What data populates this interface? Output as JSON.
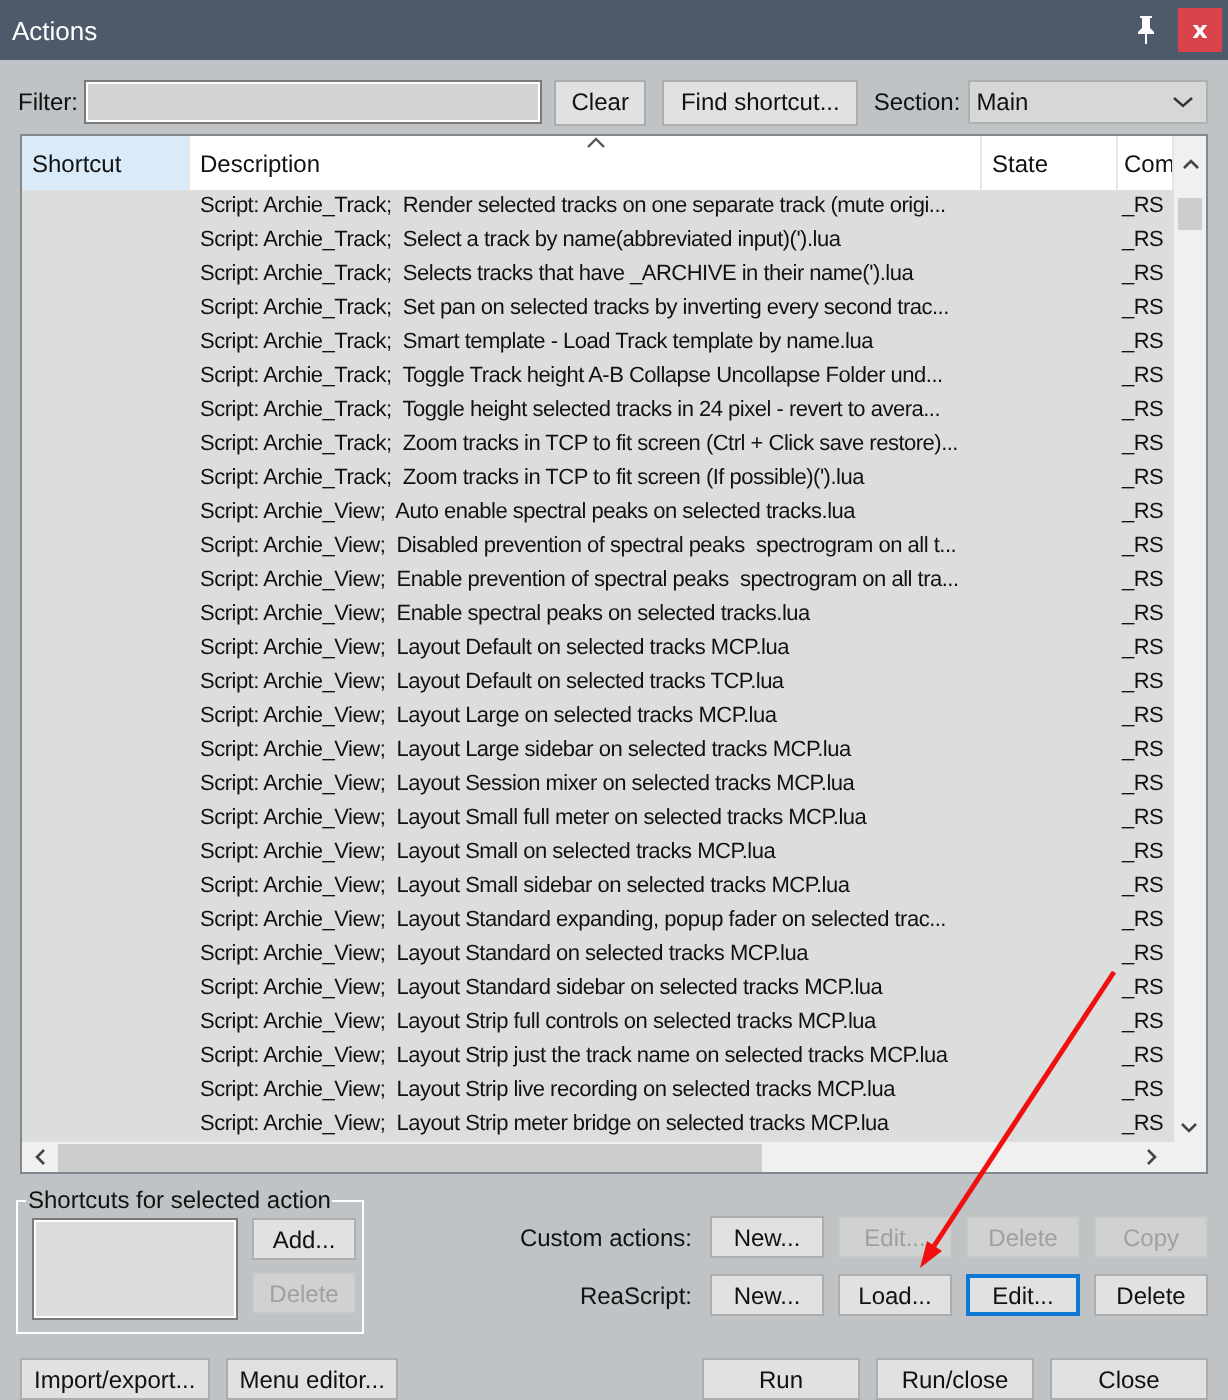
{
  "window": {
    "title": "Actions",
    "close_label": "x"
  },
  "filter": {
    "label": "Filter:"
  },
  "filter_buttons": [
    {
      "label": "Clear"
    },
    {
      "label": "Find shortcut..."
    }
  ],
  "section": {
    "label": "Section:",
    "value": "Main"
  },
  "table": {
    "columns": [
      {
        "label": "Shortcut",
        "selected": true,
        "sorted": false
      },
      {
        "label": "Description",
        "selected": false,
        "sorted": true
      },
      {
        "label": "State",
        "selected": false,
        "sorted": false
      },
      {
        "label": "Com",
        "selected": false,
        "sorted": false
      }
    ],
    "rows": [
      {
        "description": "Script: Archie_Track;  Render selected tracks on one separate track (mute origi...",
        "command": "_RS"
      },
      {
        "description": "Script: Archie_Track;  Select a track by name(abbreviated input)(').lua",
        "command": "_RS"
      },
      {
        "description": "Script: Archie_Track;  Selects tracks that have _ARCHIVE in their name(').lua",
        "command": "_RS"
      },
      {
        "description": "Script: Archie_Track;  Set pan on selected tracks by inverting every second trac...",
        "command": "_RS"
      },
      {
        "description": "Script: Archie_Track;  Smart template - Load Track template by name.lua",
        "command": "_RS"
      },
      {
        "description": "Script: Archie_Track;  Toggle Track height A-B Collapse Uncollapse Folder und...",
        "command": "_RS"
      },
      {
        "description": "Script: Archie_Track;  Toggle height selected tracks in 24 pixel - revert to avera...",
        "command": "_RS"
      },
      {
        "description": "Script: Archie_Track;  Zoom tracks in TCP to fit screen (Ctrl + Click save restore)...",
        "command": "_RS"
      },
      {
        "description": "Script: Archie_Track;  Zoom tracks in TCP to fit screen (If possible)(').lua",
        "command": "_RS"
      },
      {
        "description": "Script: Archie_View;  Auto enable spectral peaks on selected tracks.lua",
        "command": "_RS"
      },
      {
        "description": "Script: Archie_View;  Disabled prevention of spectral peaks  spectrogram on all t...",
        "command": "_RS"
      },
      {
        "description": "Script: Archie_View;  Enable prevention of spectral peaks  spectrogram on all tra...",
        "command": "_RS"
      },
      {
        "description": "Script: Archie_View;  Enable spectral peaks on selected tracks.lua",
        "command": "_RS"
      },
      {
        "description": "Script: Archie_View;  Layout Default on selected tracks MCP.lua",
        "command": "_RS"
      },
      {
        "description": "Script: Archie_View;  Layout Default on selected tracks TCP.lua",
        "command": "_RS"
      },
      {
        "description": "Script: Archie_View;  Layout Large on selected tracks MCP.lua",
        "command": "_RS"
      },
      {
        "description": "Script: Archie_View;  Layout Large sidebar on selected tracks MCP.lua",
        "command": "_RS"
      },
      {
        "description": "Script: Archie_View;  Layout Session mixer on selected tracks MCP.lua",
        "command": "_RS"
      },
      {
        "description": "Script: Archie_View;  Layout Small full meter on selected tracks MCP.lua",
        "command": "_RS"
      },
      {
        "description": "Script: Archie_View;  Layout Small on selected tracks MCP.lua",
        "command": "_RS"
      },
      {
        "description": "Script: Archie_View;  Layout Small sidebar on selected tracks MCP.lua",
        "command": "_RS"
      },
      {
        "description": "Script: Archie_View;  Layout Standard expanding, popup fader on selected trac...",
        "command": "_RS"
      },
      {
        "description": "Script: Archie_View;  Layout Standard on selected tracks MCP.lua",
        "command": "_RS"
      },
      {
        "description": "Script: Archie_View;  Layout Standard sidebar on selected tracks MCP.lua",
        "command": "_RS"
      },
      {
        "description": "Script: Archie_View;  Layout Strip full controls on selected tracks MCP.lua",
        "command": "_RS"
      },
      {
        "description": "Script: Archie_View;  Layout Strip just the track name on selected tracks MCP.lua",
        "command": "_RS"
      },
      {
        "description": "Script: Archie_View;  Layout Strip live recording on selected tracks MCP.lua",
        "command": "_RS"
      },
      {
        "description": "Script: Archie_View;  Layout Strip meter bridge on selected tracks MCP.lua",
        "command": "_RS"
      }
    ]
  },
  "shortcuts_group": {
    "title": "Shortcuts for selected action",
    "buttons": [
      {
        "label": "Add...",
        "disabled": false
      },
      {
        "label": "Delete",
        "disabled": true
      }
    ]
  },
  "action_rows": [
    {
      "label": "Custom actions:",
      "buttons": [
        {
          "label": "New...",
          "disabled": false,
          "focused": false
        },
        {
          "label": "Edit...",
          "disabled": true,
          "focused": false
        },
        {
          "label": "Delete",
          "disabled": true,
          "focused": false
        },
        {
          "label": "Copy",
          "disabled": true,
          "focused": false
        }
      ]
    },
    {
      "label": "ReaScript:",
      "buttons": [
        {
          "label": "New...",
          "disabled": false,
          "focused": false
        },
        {
          "label": "Load...",
          "disabled": false,
          "focused": false
        },
        {
          "label": "Edit...",
          "disabled": false,
          "focused": true
        },
        {
          "label": "Delete",
          "disabled": false,
          "focused": false
        }
      ]
    }
  ],
  "footer_left": [
    {
      "label": "Import/export..."
    },
    {
      "label": "Menu editor..."
    }
  ],
  "footer_right": [
    {
      "label": "Run"
    },
    {
      "label": "Run/close"
    },
    {
      "label": "Close"
    }
  ],
  "annotation": {
    "kind": "arrow"
  }
}
